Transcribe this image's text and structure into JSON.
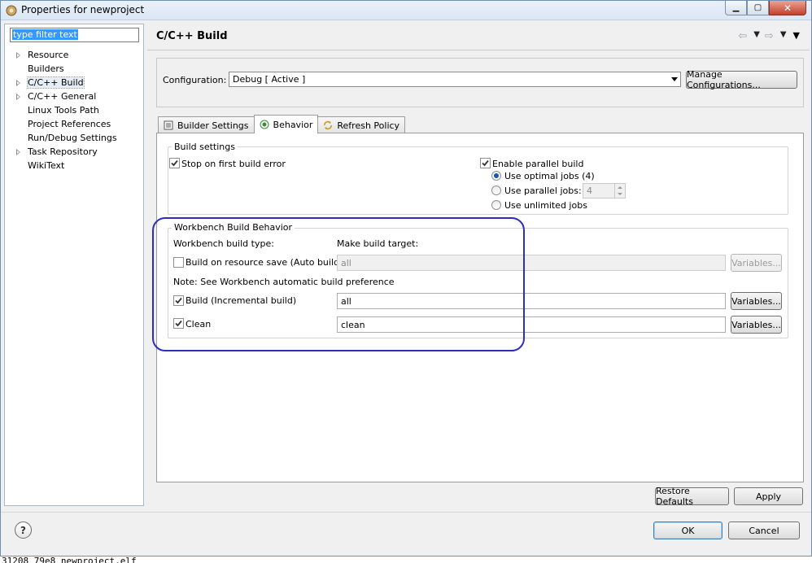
{
  "window": {
    "title": "Properties for newproject",
    "minimize_label": "▁",
    "maximize_label": "▢",
    "close_label": "✕"
  },
  "filter": {
    "value": "type filter text"
  },
  "tree": {
    "items": [
      {
        "label": "Resource",
        "expandable": true
      },
      {
        "label": "Builders",
        "expandable": false
      },
      {
        "label": "C/C++ Build",
        "expandable": true,
        "selected": true
      },
      {
        "label": "C/C++ General",
        "expandable": true
      },
      {
        "label": "Linux Tools Path",
        "expandable": false
      },
      {
        "label": "Project References",
        "expandable": false
      },
      {
        "label": "Run/Debug Settings",
        "expandable": false
      },
      {
        "label": "Task Repository",
        "expandable": true
      },
      {
        "label": "WikiText",
        "expandable": false
      }
    ]
  },
  "header": {
    "title": "C/C++ Build",
    "back_icon": "⇦",
    "forward_icon": "⇨",
    "menu_icon": "▼"
  },
  "configuration": {
    "label": "Configuration:",
    "value": "Debug  [ Active ]",
    "manage_label": "Manage Configurations..."
  },
  "tabs": [
    {
      "label": "Builder Settings",
      "icon": "builder-settings-icon",
      "active": false
    },
    {
      "label": "Behavior",
      "icon": "behavior-icon",
      "active": true
    },
    {
      "label": "Refresh Policy",
      "icon": "refresh-policy-icon",
      "active": false
    }
  ],
  "build_settings": {
    "title": "Build settings",
    "stop_on_error": {
      "label": "Stop on first build error",
      "checked": true
    },
    "parallel": {
      "label": "Enable parallel build",
      "checked": true
    },
    "optimal_jobs": {
      "label": "Use optimal jobs (4)",
      "selected": true
    },
    "parallel_jobs": {
      "label": "Use parallel jobs:",
      "selected": false,
      "value": "4"
    },
    "unlimited_jobs": {
      "label": "Use unlimited jobs",
      "selected": false
    }
  },
  "workbench": {
    "title": "Workbench Build Behavior",
    "type_label": "Workbench build type:",
    "target_label": "Make build target:",
    "auto_build": {
      "label": "Build on resource save (Auto build)",
      "checked": false,
      "target": "all",
      "variables_label": "Variables..."
    },
    "note": "Note: See Workbench automatic build preference",
    "incremental": {
      "label": "Build (Incremental build)",
      "checked": true,
      "target": "all",
      "variables_label": "Variables..."
    },
    "clean": {
      "label": "Clean",
      "checked": true,
      "target": "clean",
      "variables_label": "Variables..."
    }
  },
  "page_buttons": {
    "restore_defaults": "Restore Defaults",
    "apply": "Apply"
  },
  "dialog_buttons": {
    "ok": "OK",
    "cancel": "Cancel"
  },
  "help_label": "?",
  "background_text": "31208     79e8 newproject.elf",
  "colors": {
    "annotation": "#2b2fc0",
    "selection": "#3399ff"
  }
}
